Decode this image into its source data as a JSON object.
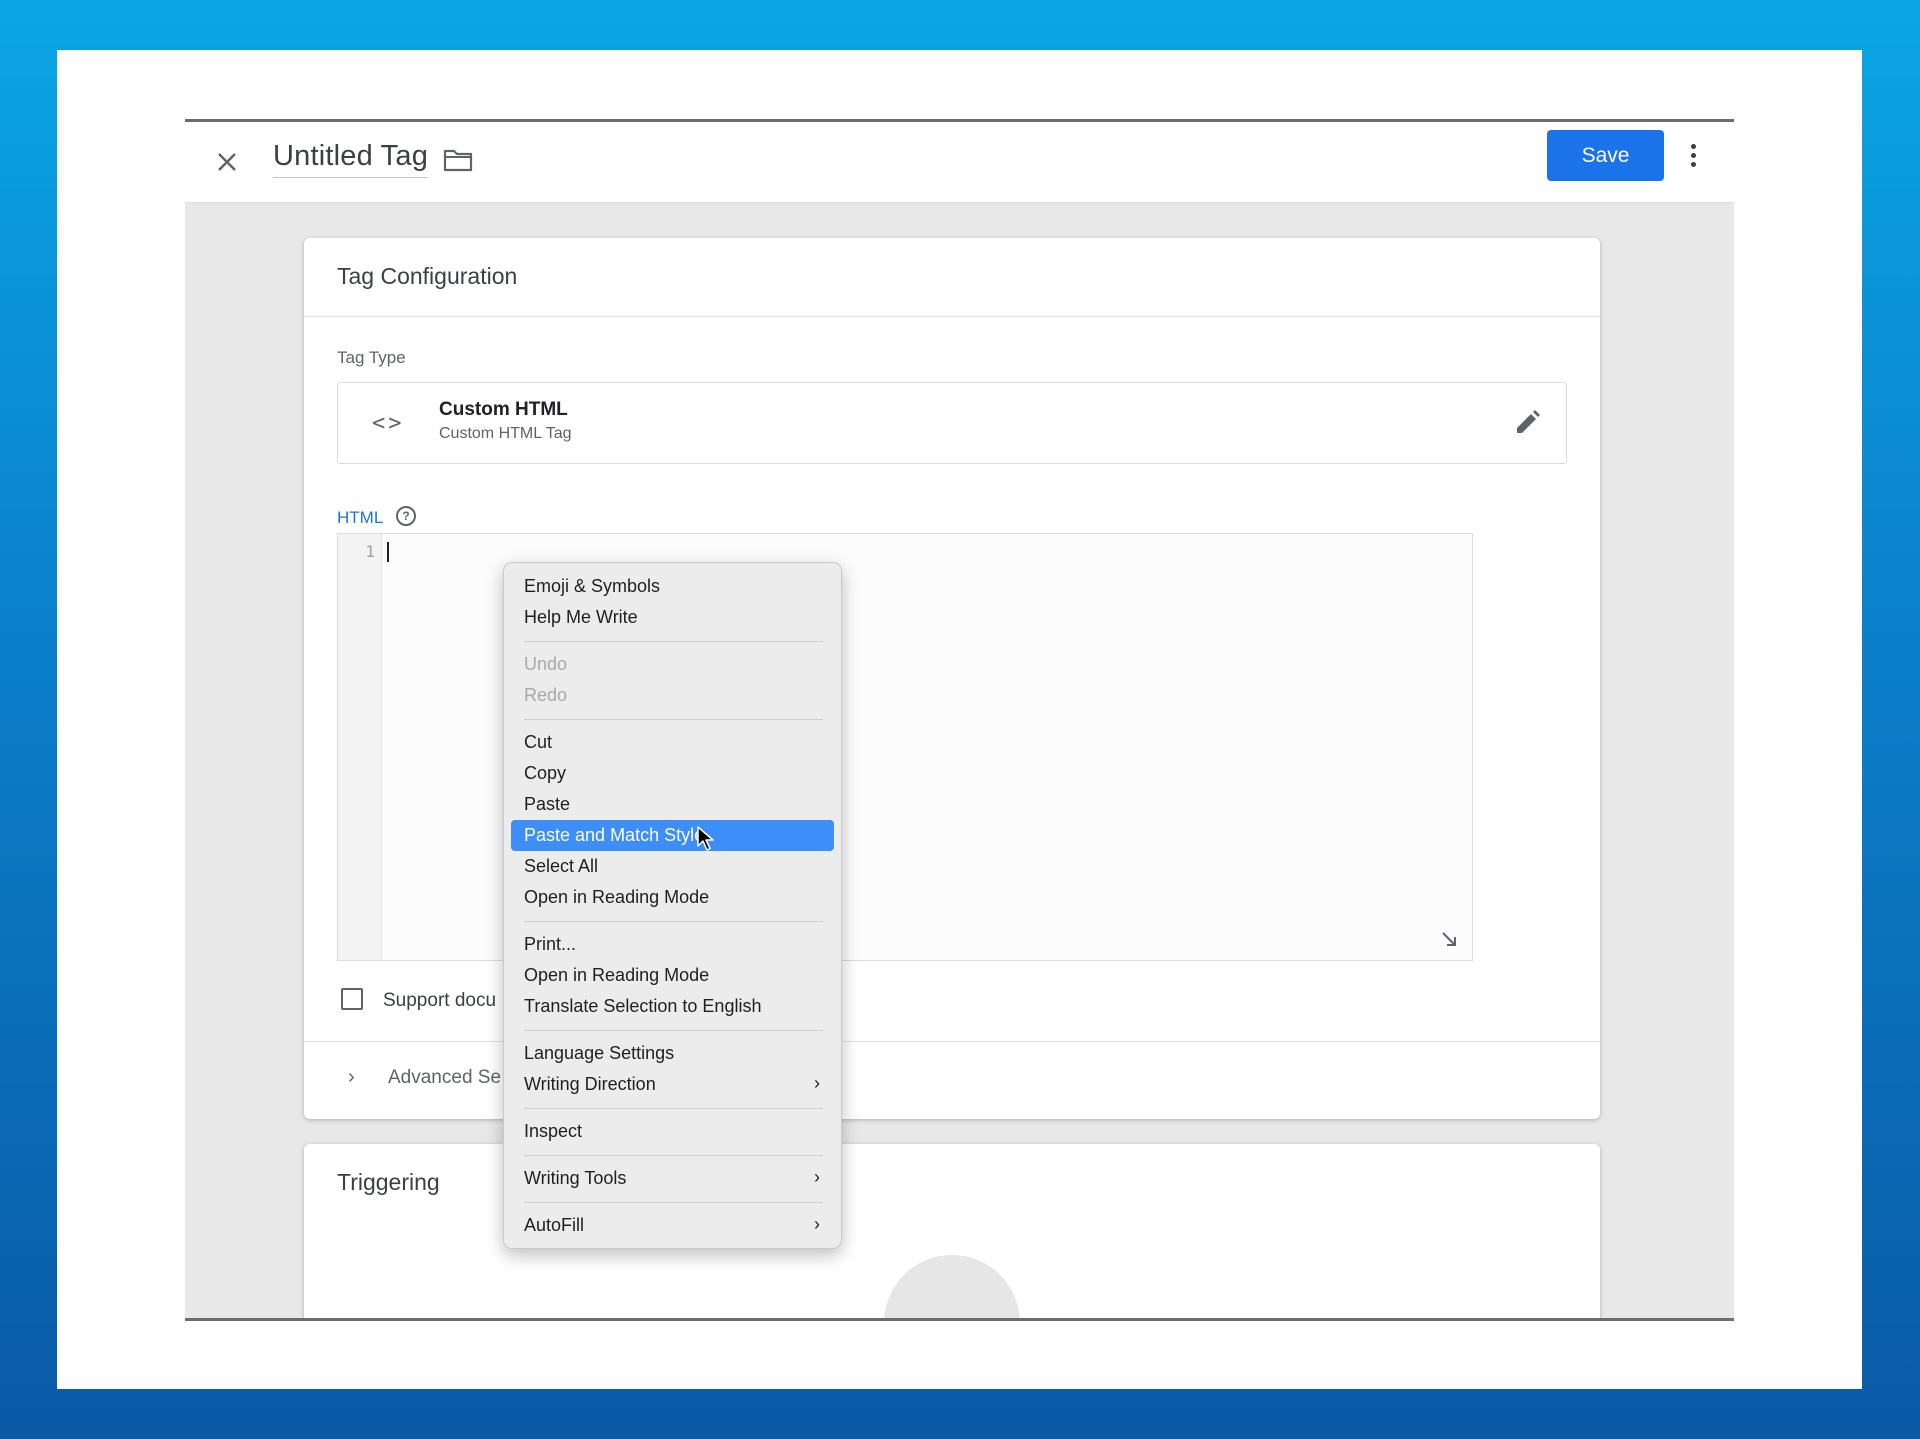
{
  "window": {
    "title": "Untitled Tag",
    "save_label": "Save"
  },
  "tag_configuration": {
    "title": "Tag Configuration",
    "tag_type_label": "Tag Type",
    "tag_type_name": "Custom HTML",
    "tag_type_sub": "Custom HTML Tag",
    "html_label": "HTML",
    "help_glyph": "?",
    "code_icon_glyph": "<>",
    "line_number": "1",
    "checkbox_label": "Support docu",
    "advanced_chevron": "›",
    "advanced_label": "Advanced Se"
  },
  "triggering": {
    "title": "Triggering"
  },
  "context_menu": {
    "items": [
      {
        "label": "Emoji & Symbols"
      },
      {
        "label": "Help Me Write"
      },
      {
        "label": "Undo",
        "disabled": true
      },
      {
        "label": "Redo",
        "disabled": true
      },
      {
        "label": "Cut"
      },
      {
        "label": "Copy"
      },
      {
        "label": "Paste"
      },
      {
        "label": "Paste and Match Style",
        "highlighted": true
      },
      {
        "label": "Select All"
      },
      {
        "label": "Open in Reading Mode"
      },
      {
        "label": "Print..."
      },
      {
        "label": "Open in Reading Mode"
      },
      {
        "label": "Translate Selection to English"
      },
      {
        "label": "Language Settings"
      },
      {
        "label": "Writing Direction",
        "submenu": true
      },
      {
        "label": "Inspect"
      },
      {
        "label": "Writing Tools",
        "submenu": true
      },
      {
        "label": "AutoFill",
        "submenu": true
      }
    ],
    "submenu_glyph": "›"
  },
  "colors": {
    "accent": "#1a73e8",
    "menu_highlight": "#3d8ef8",
    "background_gradient_top": "#0aa6e3",
    "background_gradient_bottom": "#0a5aa6"
  }
}
